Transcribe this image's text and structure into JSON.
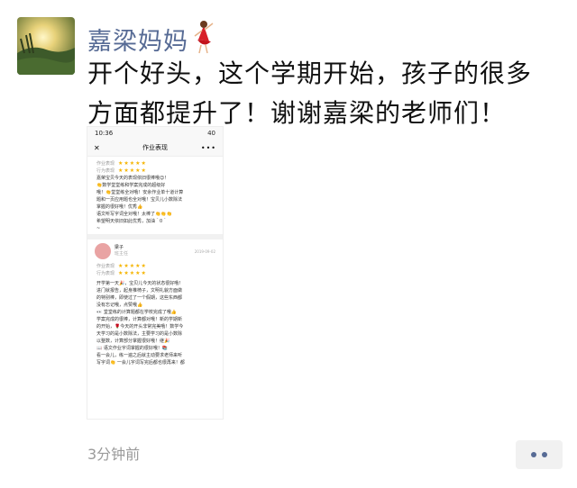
{
  "post": {
    "username": "嘉梁妈妈",
    "text": "开个好头，这个学期开始，孩子的很多方面都提升了！谢谢嘉梁的老师们！",
    "time": "3分钟前",
    "avatar_icon": "avatar-landscape",
    "emoji_icon": "dancer-emoji"
  },
  "screenshot": {
    "status_time": "10:36",
    "status_battery": "40",
    "nav_title": "作业表现",
    "card1": {
      "rating1_label": "作业表现",
      "rating2_label": "行为表现",
      "lines": [
        "嘉荣宝贝今天的表现依旧很棒哦😊！",
        "👏数学堂堂练和学案完成的超级好",
        "哦！👏堂堂练全对哦！安余作业单十道计算",
        "题和一页应用题也全对哦！宝贝儿小数除法",
        "掌握的很好哦！优秀👍",
        "语文听写字词全对哦！太棒了👏👏👏",
        "希望明天依旧如此优秀，加油＾0＾",
        "~"
      ]
    },
    "card2": {
      "teacher_name": "梁子",
      "teacher_role": "班主任",
      "date": "2019-09-02",
      "rating1_label": "作业表现",
      "rating2_label": "行为表现",
      "lines": [
        "开学第一天🎉，宝贝儿今天的状态很好哦！",
        "进门就报告，起身推椅子，文明礼貌方面做",
        "的特别棒，即使过了一个假期，这些东西都",
        "没有忘记哦，点赞哦👍",
        "👀 堂堂练的计算题都在学校完成了哦👍",
        "学案完成的很棒，计算都对哦！新的学期新",
        "的开始，🌹今天的开头非常完美哦！数学今",
        "天学习的是小数除法，主要学习的是小数除",
        "以整数，计算部分掌握很好哦！继🎉",
        "📖 语文作业字词掌握的很好哦！📚",
        "看一会儿，练一遍之后就主动要求老师来听",
        "写字词👏 一会儿字词写完后都也很再来！都"
      ]
    }
  }
}
